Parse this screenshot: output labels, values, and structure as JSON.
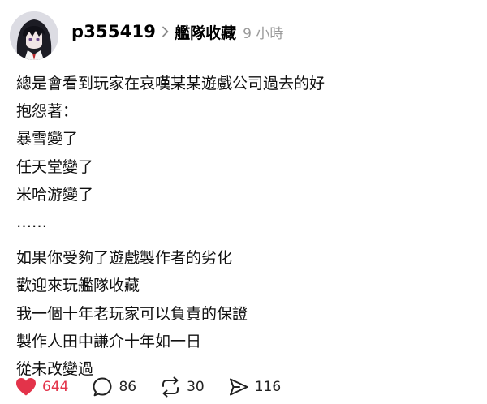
{
  "author": {
    "username": "p355419",
    "feed_name": "艦隊收藏",
    "time_ago": "9 小時"
  },
  "post": {
    "paragraph1": [
      "總是會看到玩家在哀嘆某某遊戲公司過去的好",
      "抱怨著：",
      "暴雪變了",
      "任天堂變了",
      "米哈游變了",
      "……"
    ],
    "paragraph2": [
      "如果你受夠了遊戲製作者的劣化",
      "歡迎來玩艦隊收藏",
      "我一個十年老玩家可以負責的保證",
      "製作人田中謙介十年如一日",
      "從未改變過"
    ]
  },
  "actions": {
    "like": {
      "icon": "heart-filled-icon",
      "count": "644",
      "color": "#e3334a"
    },
    "comment": {
      "icon": "comment-icon",
      "count": "86"
    },
    "repost": {
      "icon": "repost-icon",
      "count": "30"
    },
    "share": {
      "icon": "send-icon",
      "count": "116"
    }
  }
}
